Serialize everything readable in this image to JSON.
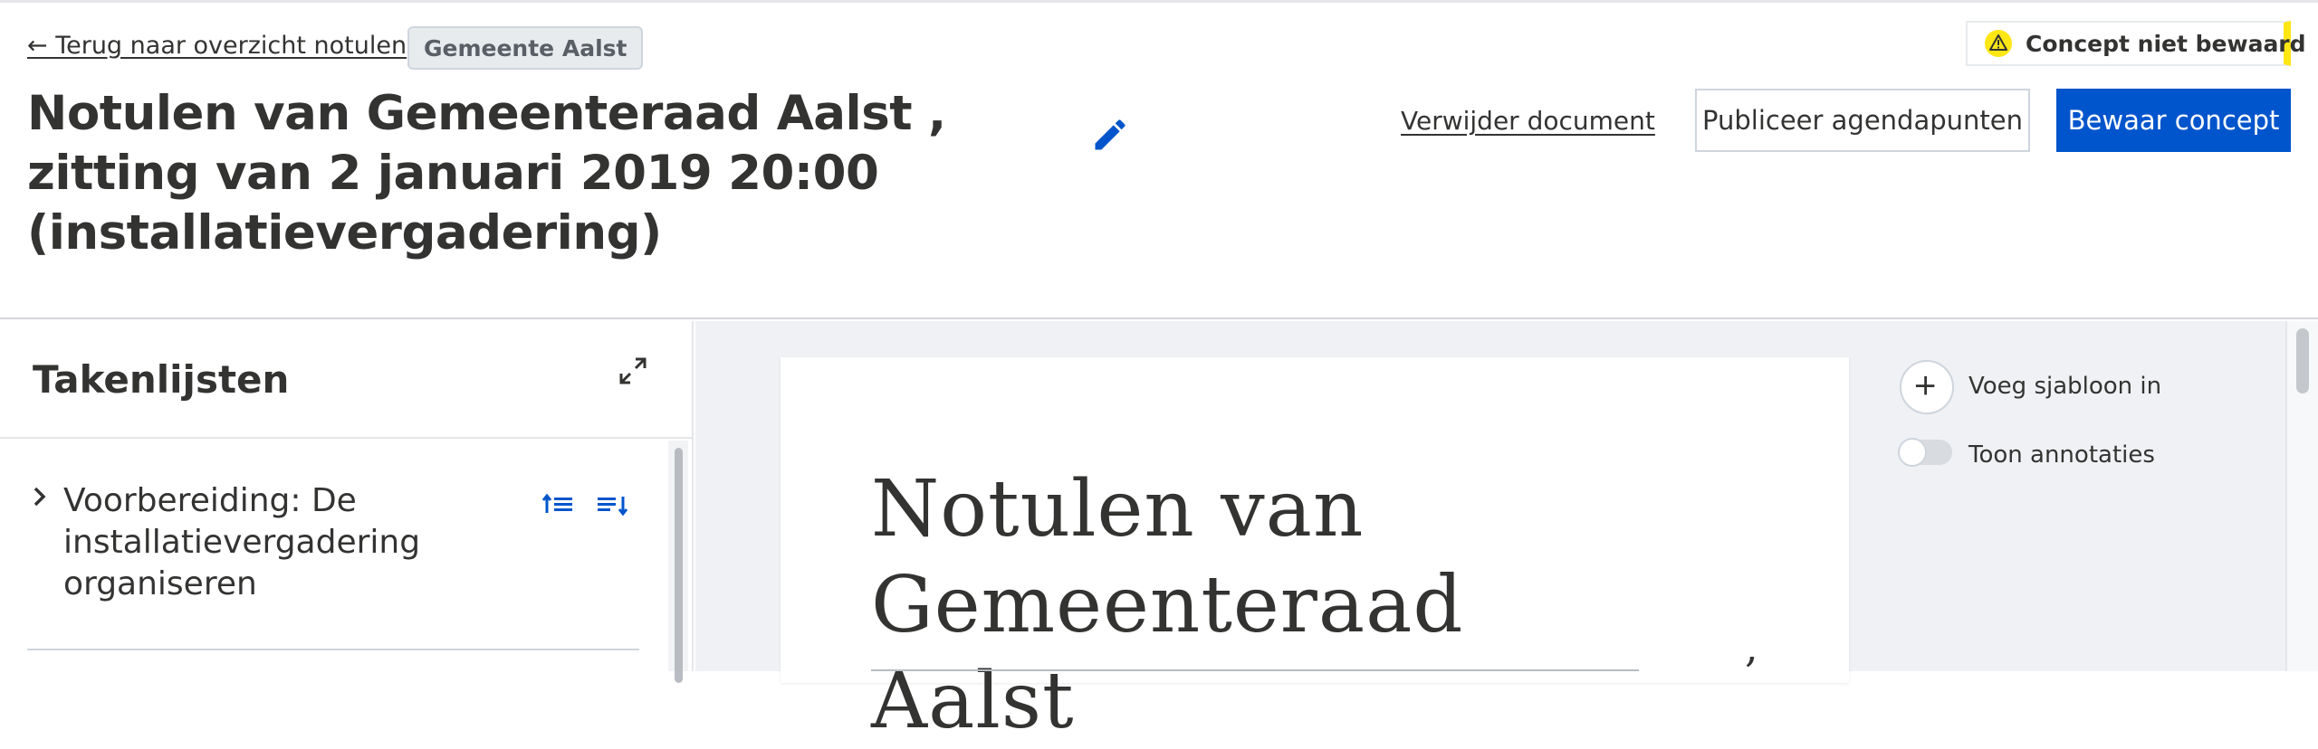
{
  "header": {
    "back_link": "← Terug naar overzicht notulen",
    "organization": "Gemeente Aalst",
    "title": "Notulen van Gemeenteraad Aalst , zitting van 2 januari 2019 20:00 (installatievergadering)",
    "status": "Concept niet bewaard",
    "delete_link": "Verwijder document",
    "publish_button": "Publiceer agendapunten",
    "save_button": "Bewaar concept"
  },
  "sidebar": {
    "title": "Takenlijsten",
    "tasks": [
      {
        "label": "Voorbereiding: De installatievergadering organiseren"
      }
    ]
  },
  "editor": {
    "doc_title": "Notulen van Gemeenteraad Aalst",
    "doc_comma": ","
  },
  "tools": {
    "insert_template": "Voeg sjabloon in",
    "show_annotations": "Toon annotaties",
    "show_annotations_on": false
  },
  "colors": {
    "primary": "#0055cc",
    "warning": "#ffe615",
    "text": "#333332",
    "canvas_bg": "#eff1f4"
  }
}
